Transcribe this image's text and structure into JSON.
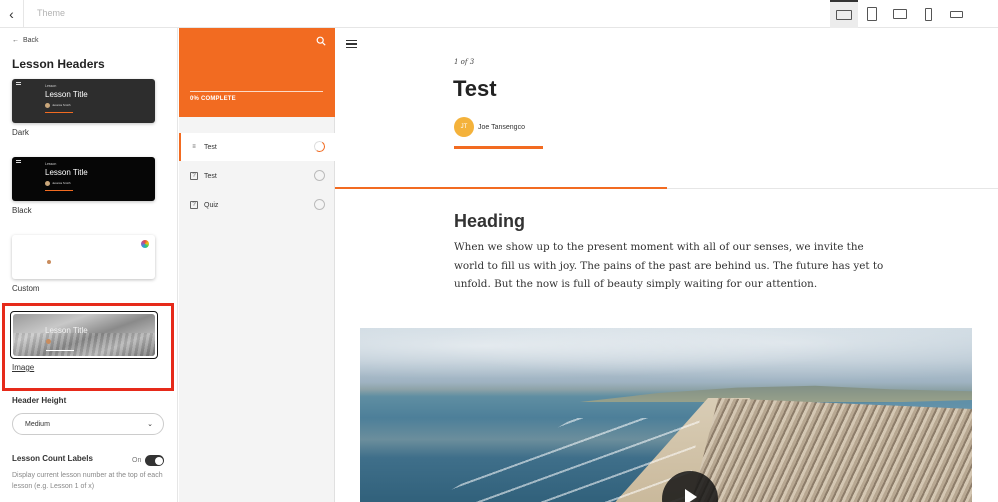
{
  "topbar": {
    "title": "Theme",
    "devices": [
      "laptop-icon",
      "tablet-portrait-icon",
      "tablet-landscape-icon",
      "phone-portrait-icon",
      "phone-landscape-icon"
    ]
  },
  "sidebar": {
    "back_label": "Back",
    "title": "Lesson Headers",
    "thumbs": {
      "small_label": "Lesson",
      "title": "Lesson Title",
      "author": "Jessica Smith"
    },
    "options": [
      {
        "label": "Dark"
      },
      {
        "label": "Black"
      },
      {
        "label": "Custom"
      },
      {
        "label": "Image",
        "selected": true
      }
    ],
    "header_height_label": "Header Height",
    "header_height_value": "Medium",
    "lesson_count_label": "Lesson Count Labels",
    "toggle_state_label": "On",
    "help_text": "Display current lesson number at the top of each lesson (e.g. Lesson 1 of x)"
  },
  "outline": {
    "progress_text": "0% COMPLETE",
    "items": [
      {
        "label": "Test",
        "icon": "text-lines-icon",
        "active": true,
        "status": "in-progress"
      },
      {
        "label": "Test",
        "icon": "question-box-icon",
        "active": false,
        "status": "not-started"
      },
      {
        "label": "Quiz",
        "icon": "question-box-icon",
        "active": false,
        "status": "not-started"
      }
    ]
  },
  "lesson": {
    "count": "1 of 3",
    "title": "Test",
    "author_initials": "JT",
    "author_name": "Joe Tansengco",
    "progress": 0.5,
    "heading": "Heading",
    "body": "When we show up to the present moment with all of our senses, we invite the world to fill us with joy. The pains of the past are behind us. The future has yet to unfold. But the now is full of beauty simply waiting for our attention."
  },
  "colors": {
    "accent": "#f26b21",
    "highlight": "#e62a1a",
    "avatar": "#f4b23b"
  }
}
